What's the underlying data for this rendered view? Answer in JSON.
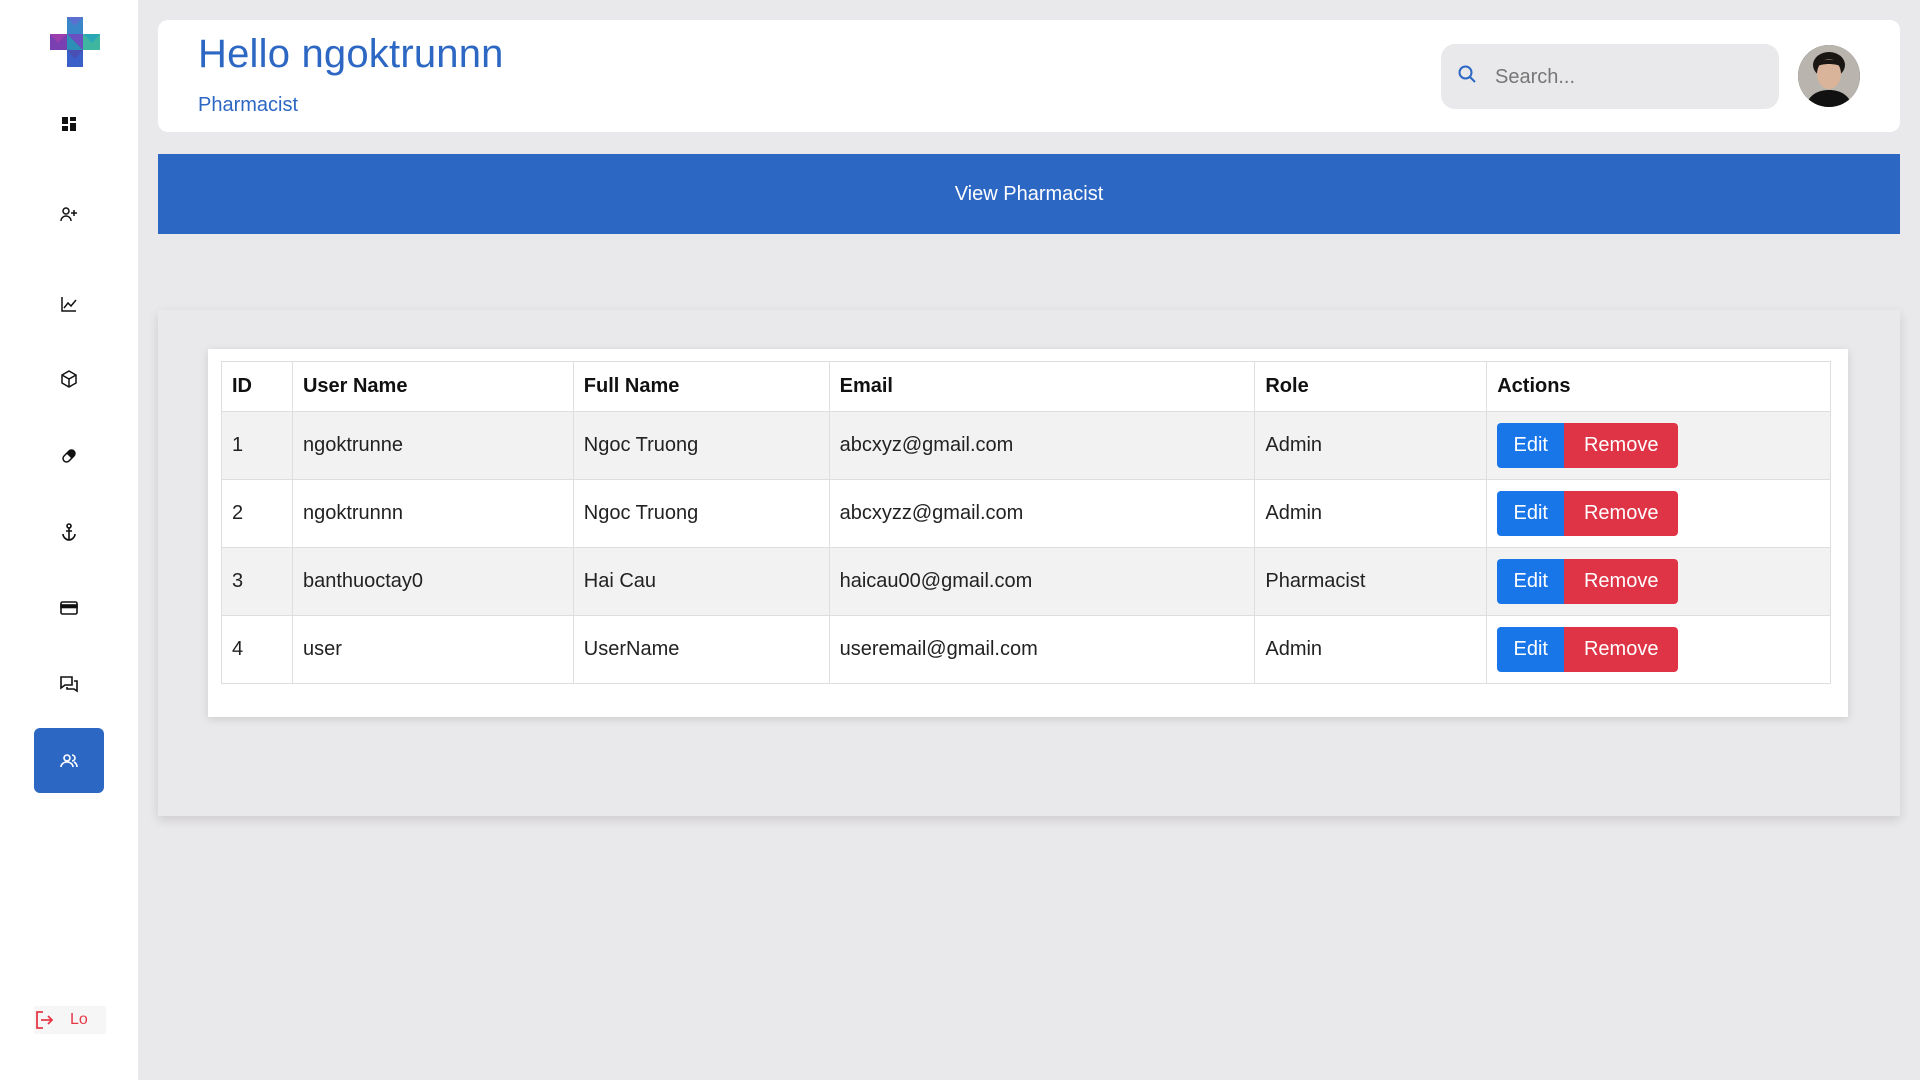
{
  "header": {
    "greeting": "Hello ngoktrunnn",
    "role": "Pharmacist",
    "search_placeholder": "Search..."
  },
  "banner": {
    "title": "View Pharmacist"
  },
  "sidebar": {
    "items": [
      {
        "icon": "dashboard-icon"
      },
      {
        "icon": "add-user-icon"
      },
      {
        "icon": "chart-icon"
      },
      {
        "icon": "package-icon"
      },
      {
        "icon": "pill-icon"
      },
      {
        "icon": "anchor-icon"
      },
      {
        "icon": "credit-card-icon"
      },
      {
        "icon": "chat-icon"
      },
      {
        "icon": "users-icon",
        "active": true
      }
    ],
    "logout_label": "Lo"
  },
  "table": {
    "columns": [
      "ID",
      "User Name",
      "Full Name",
      "Email",
      "Role",
      "Actions"
    ],
    "rows": [
      {
        "id": "1",
        "username": "ngoktrunne",
        "fullname": "Ngoc Truong",
        "email": "abcxyz@gmail.com",
        "role": "Admin"
      },
      {
        "id": "2",
        "username": "ngoktrunnn",
        "fullname": "Ngoc Truong",
        "email": "abcxyzz@gmail.com",
        "role": "Admin"
      },
      {
        "id": "3",
        "username": "banthuoctay0",
        "fullname": "Hai Cau",
        "email": "haicau00@gmail.com",
        "role": "Pharmacist"
      },
      {
        "id": "4",
        "username": "user",
        "fullname": "UserName",
        "email": "useremail@gmail.com",
        "role": "Admin"
      }
    ],
    "edit_label": "Edit",
    "remove_label": "Remove"
  },
  "colors": {
    "primary": "#2d67c4",
    "edit": "#1976e8",
    "remove": "#df3446",
    "background": "#e9e8ea"
  }
}
